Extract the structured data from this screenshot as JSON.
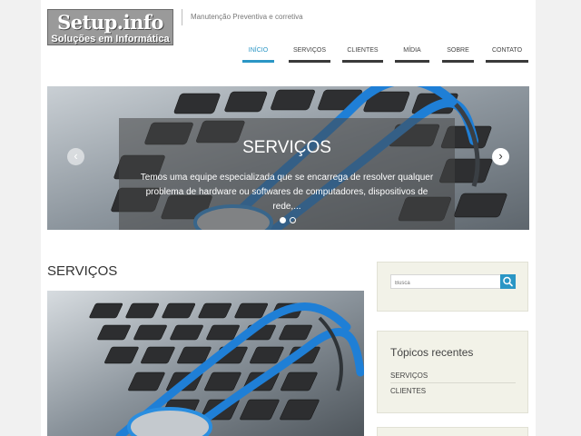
{
  "header": {
    "logo": {
      "title": "Setup.info",
      "subtitle": "Soluções em Informática"
    },
    "tagline": "Manutenção Preventiva e corretiva"
  },
  "nav": {
    "items": [
      {
        "label": "INÍCIO",
        "active": true
      },
      {
        "label": "SERVIÇOS",
        "active": false
      },
      {
        "label": "CLIENTES",
        "active": false
      },
      {
        "label": "MÍDIA",
        "active": false
      },
      {
        "label": "SOBRE",
        "active": false
      },
      {
        "label": "CONTATO",
        "active": false
      }
    ]
  },
  "slider": {
    "title": "SERVIÇOS",
    "text": "Temos uma equipe especializada que se encarrega de resolver qualquer problema de hardware ou softwares de computadores, dispositivos de rede,...",
    "prev_icon": "chevron-left-icon",
    "next_icon": "chevron-right-icon",
    "slide_count": 2,
    "active_slide": 1
  },
  "main": {
    "heading": "SERVIÇOS",
    "image": "keyboard-stethoscope-photo"
  },
  "sidebar": {
    "search": {
      "placeholder": "Busca",
      "icon": "search-icon"
    },
    "recent": {
      "title": "Tópicos recentes",
      "links": [
        "SERVIÇOS",
        "CLIENTES"
      ]
    }
  },
  "colors": {
    "accent": "#2a96c5",
    "nav_underline": "#3a3a3a",
    "page_background": "#f1f1f1",
    "widget_background": "#f2f2e8"
  }
}
